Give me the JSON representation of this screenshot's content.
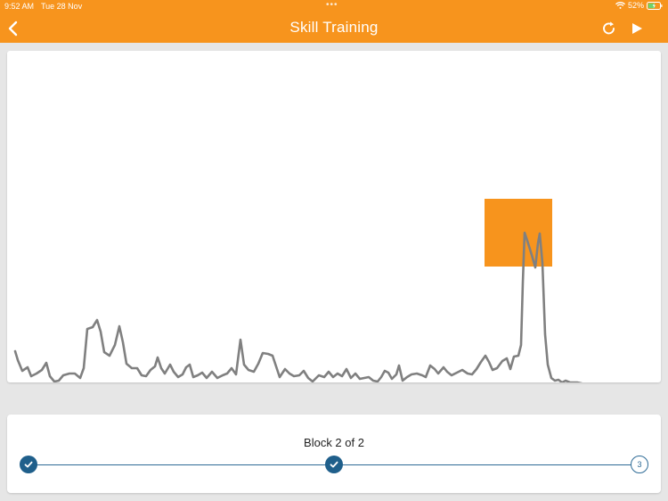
{
  "status_bar": {
    "time": "9:52 AM",
    "date": "Tue 28 Nov",
    "battery_percent": "52%"
  },
  "header": {
    "title": "Skill Training",
    "accent_color": "#f7941d",
    "icons": [
      "chevron-left-icon",
      "reset-icon",
      "play-icon"
    ]
  },
  "signal_chart": {
    "line_color": "#808080",
    "target_color": "#f7941d"
  },
  "progress": {
    "label": "Block 2 of 2",
    "steps": [
      {
        "state": "completed",
        "icon": "checkmark-icon"
      },
      {
        "state": "completed",
        "icon": "checkmark-icon"
      },
      {
        "state": "pending",
        "number": "3"
      }
    ],
    "track_color": "#2e6b96"
  }
}
